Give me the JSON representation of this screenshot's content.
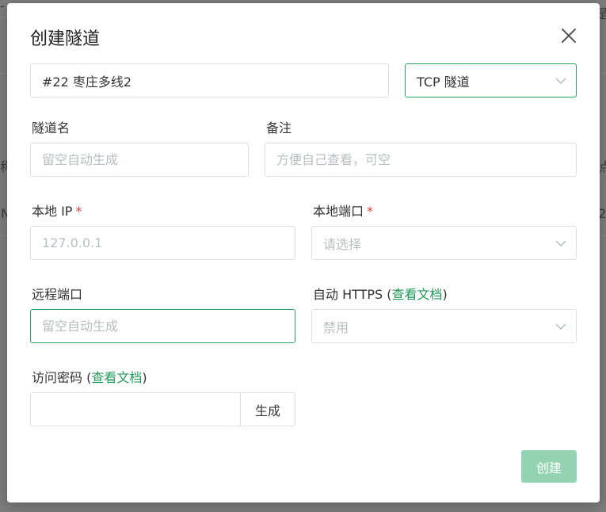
{
  "modal": {
    "title": "创建隧道",
    "tunnel_node": "#22 枣庄多线2",
    "tunnel_type": "TCP 隧道",
    "name_label": "隧道名",
    "name_placeholder": "留空自动生成",
    "note_label": "备注",
    "note_placeholder": "方便自己查看，可空",
    "local_ip_label": "本地 IP",
    "local_ip_placeholder": "127.0.0.1",
    "local_port_label": "本地端口",
    "local_port_placeholder": "请选择",
    "required_mark": "*",
    "remote_port_label": "远程端口",
    "remote_port_placeholder": "留空自动生成",
    "https_label_prefix": "自动 HTTPS (",
    "https_link": "查看文档",
    "https_label_suffix": ")",
    "https_value": "禁用",
    "password_label_prefix": "访问密码 (",
    "password_link": "查看文档",
    "password_label_suffix": ")",
    "password_value": "",
    "generate_label": "生成",
    "create_label": "创建"
  },
  "background": {
    "frag_top_right": "是",
    "frag_left_1": "称",
    "frag_right_1": "点",
    "frag_left_2": "N",
    "frag_right_2": "2",
    "frag_top_left": "-"
  },
  "colors": {
    "accent": "#1f9a57",
    "focus_border": "#2aa26a",
    "create_button": "#93d3b4",
    "required": "#e0413b"
  }
}
